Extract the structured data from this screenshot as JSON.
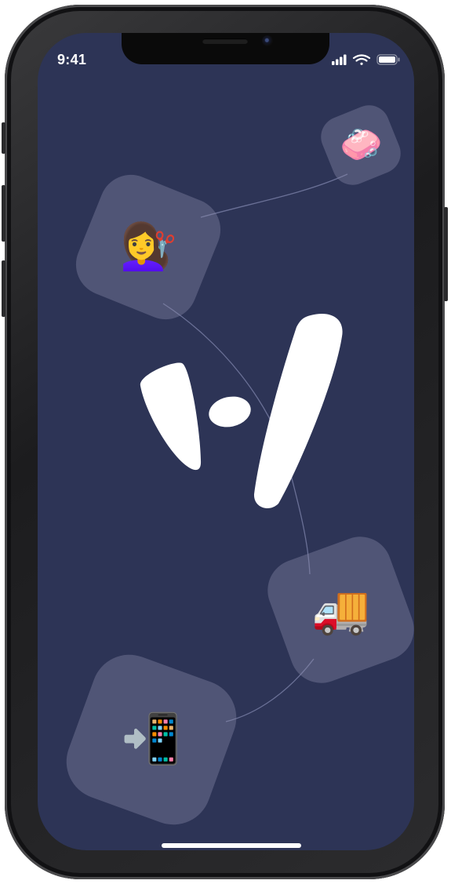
{
  "status_bar": {
    "time": "9:41",
    "icons": [
      "cellular-signal-icon",
      "wifi-icon",
      "battery-icon"
    ]
  },
  "theme": {
    "screen_background": "#2d3456",
    "tile_background": "rgba(140,140,170,0.38)",
    "logo_color": "#ffffff",
    "path_color": "#6a7096"
  },
  "logo": {
    "icon": "brand-logo-icon"
  },
  "tiles": [
    {
      "icon": "soap-icon",
      "emoji": "🧼"
    },
    {
      "icon": "woman-getting-haircut-icon",
      "emoji": "💇‍♀️"
    },
    {
      "icon": "delivery-truck-icon",
      "emoji": "🚚"
    },
    {
      "icon": "mobile-phone-with-arrow-icon",
      "emoji": "📲"
    }
  ]
}
